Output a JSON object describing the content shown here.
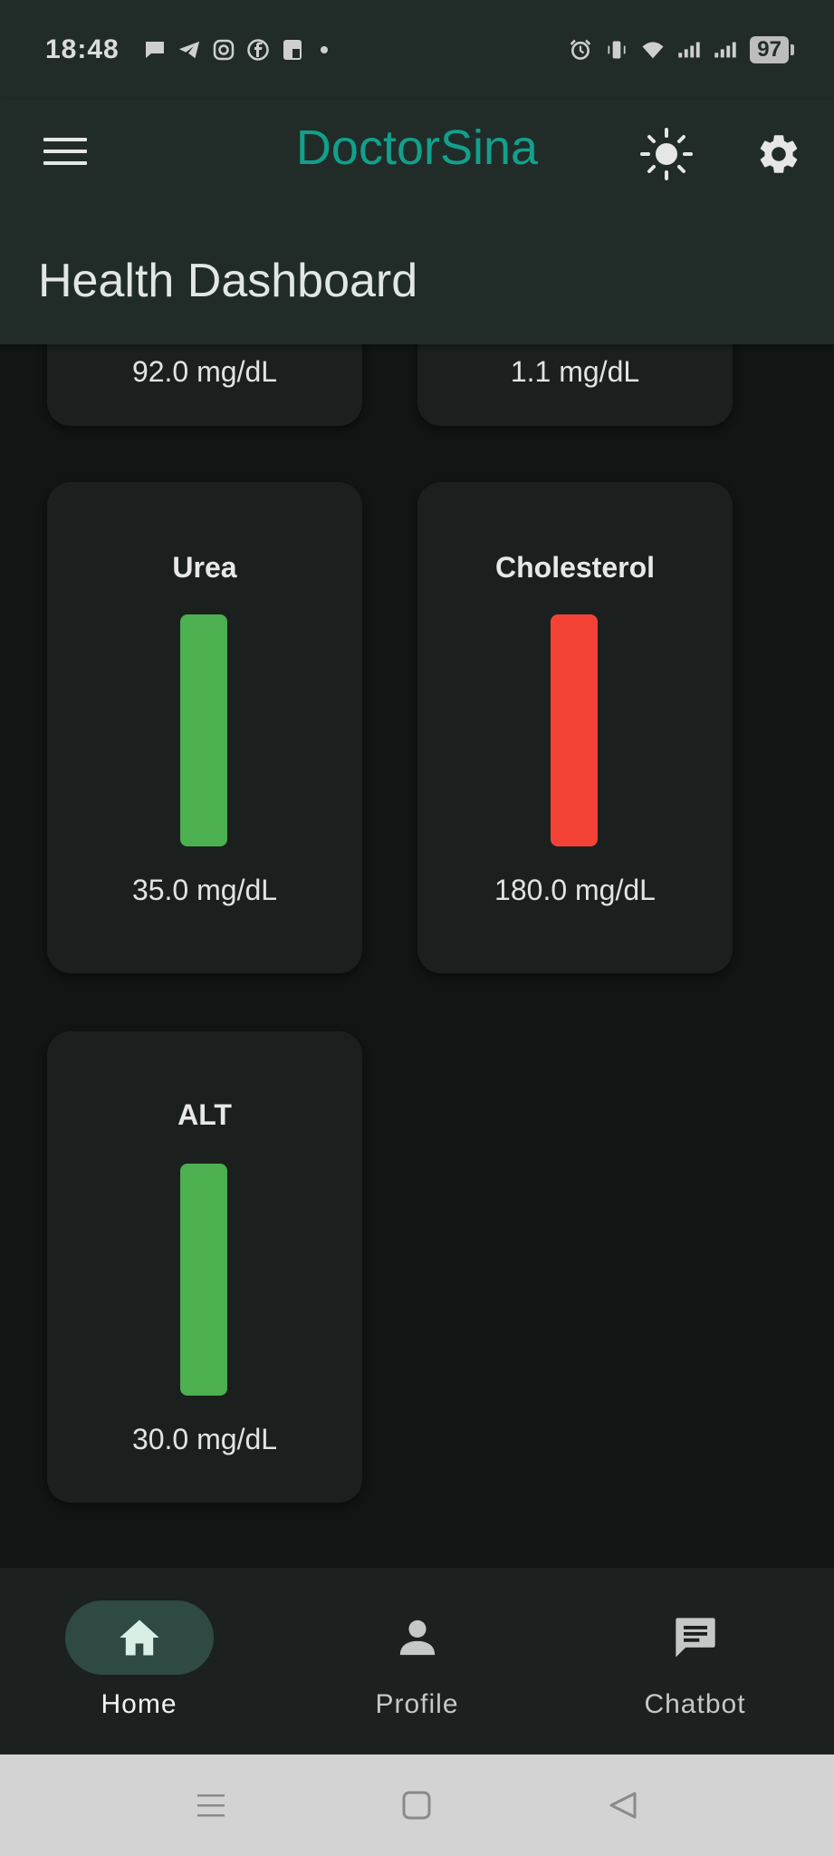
{
  "status_bar": {
    "time": "18:48",
    "battery": "97",
    "left_icons": [
      "chat-bubble-icon",
      "telegram-icon",
      "instagram-icon",
      "facebook-icon",
      "app-icon"
    ],
    "right_icons": [
      "alarm-icon",
      "vibrate-icon",
      "wifi-icon",
      "signal-icon",
      "signal-icon"
    ]
  },
  "app_bar": {
    "title": "DoctorSina",
    "page_title": "Health Dashboard",
    "menu_icon": "menu-icon",
    "theme_icon": "sun-icon",
    "settings_icon": "gear-icon",
    "title_color": "#12a08c"
  },
  "cards": [
    {
      "title": "",
      "value": "92.0 mg/dL",
      "status": "normal"
    },
    {
      "title": "",
      "value": "1.1 mg/dL",
      "status": "normal"
    },
    {
      "title": "Urea",
      "value": "35.0 mg/dL",
      "status": "normal",
      "color": "#4caf50"
    },
    {
      "title": "Cholesterol",
      "value": "180.0 mg/dL",
      "status": "high",
      "color": "#f44336"
    },
    {
      "title": "ALT",
      "value": "30.0 mg/dL",
      "status": "normal",
      "color": "#4caf50"
    }
  ],
  "bottom_nav": {
    "items": [
      {
        "label": "Home",
        "icon": "home-icon",
        "active": true
      },
      {
        "label": "Profile",
        "icon": "person-icon",
        "active": false
      },
      {
        "label": "Chatbot",
        "icon": "chat-icon",
        "active": false
      }
    ],
    "active_color": "#2e4a43"
  },
  "system_nav": {
    "buttons": [
      "recents-icon",
      "home-square-icon",
      "back-triangle-icon"
    ]
  }
}
